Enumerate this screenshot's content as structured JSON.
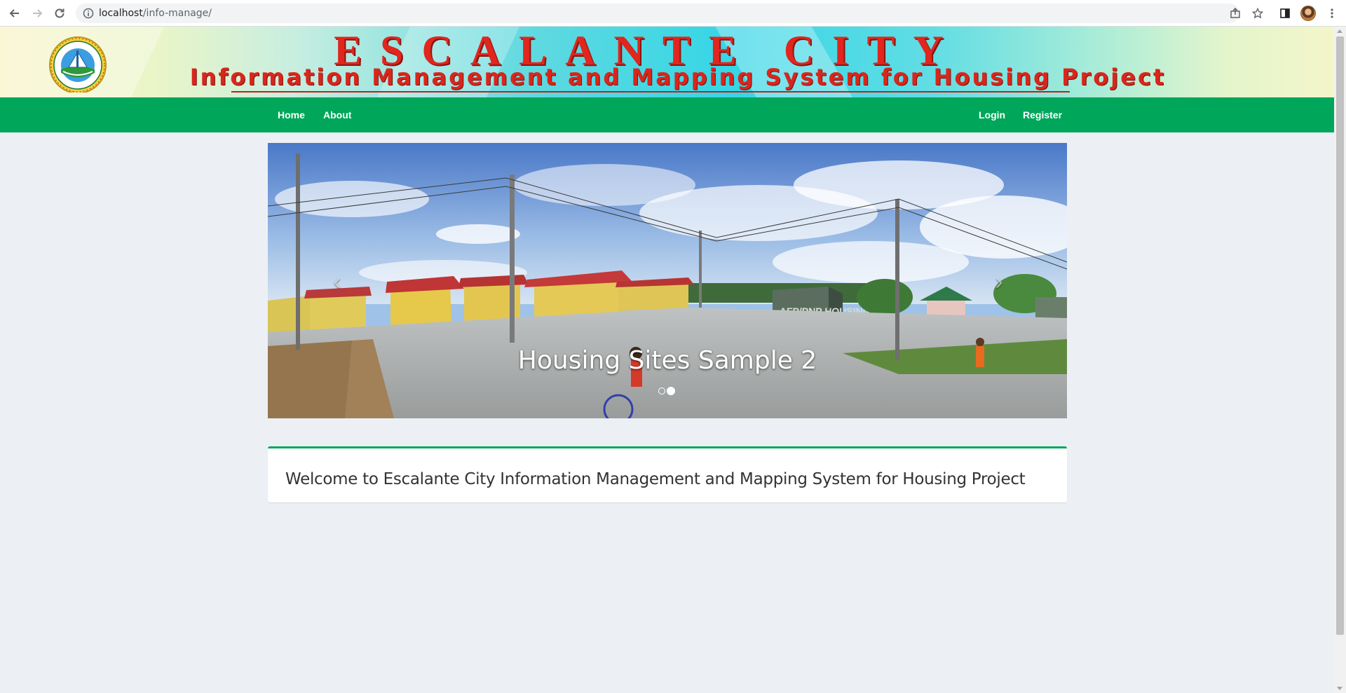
{
  "browser": {
    "url_host": "localhost",
    "url_path": "/info-manage/",
    "icons": [
      "back-arrow-icon",
      "forward-arrow-icon",
      "reload-icon",
      "info-icon",
      "share-icon",
      "star-icon",
      "sidepanel-icon",
      "more-vert-icon"
    ]
  },
  "header": {
    "title": "ESCALANTE CITY",
    "subtitle": "Information Management and Mapping System for Housing Project",
    "seal": {
      "top_text": "CITY OF ESCALANTE",
      "bottom_text": "NEGROS OCCIDENTAL"
    }
  },
  "nav": {
    "left": [
      {
        "label": "Home"
      },
      {
        "label": "About"
      }
    ],
    "right": [
      {
        "label": "Login"
      },
      {
        "label": "Register"
      }
    ]
  },
  "carousel": {
    "caption": "Housing Sites Sample 2",
    "slide_count": 2,
    "active_index": 1,
    "prev_icon": "chevron-left-icon",
    "next_icon": "chevron-right-icon",
    "sign_text": "AFP/PNP HOUSING"
  },
  "welcome": {
    "text": "Welcome to Escalante City Information Management and Mapping System for Housing Project"
  },
  "colors": {
    "nav_green": "#00a65a",
    "page_bg": "#ecf0f5",
    "title_red": "#e0261d"
  }
}
